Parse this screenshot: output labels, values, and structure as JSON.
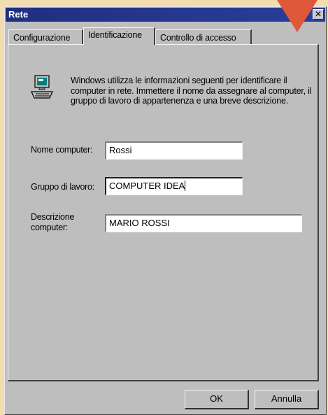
{
  "window": {
    "title": "Rete",
    "close_glyph": "✕"
  },
  "tabs": [
    {
      "label": "Configurazione",
      "active": false
    },
    {
      "label": "Identificazione",
      "active": true
    },
    {
      "label": "Controllo di accesso",
      "active": false
    }
  ],
  "identification": {
    "icon": "computer-icon",
    "info": "Windows utilizza le informazioni seguenti per identificare il computer in rete. Immettere il nome da assegnare al computer, il gruppo di lavoro di appartenenza e una breve descrizione.",
    "computer_name": {
      "label": "Nome computer:",
      "value": "Rossi"
    },
    "workgroup": {
      "label": "Gruppo di lavoro:",
      "value": "COMPUTER IDEA"
    },
    "description": {
      "label_line1": "Descrizione",
      "label_line2": "computer:",
      "value": "MARIO ROSSI"
    }
  },
  "buttons": {
    "ok": "OK",
    "cancel": "Annulla"
  },
  "colors": {
    "background": "#f2ddb0",
    "dialog": "#bebebe",
    "titlebar": "#1f2f80",
    "arrow": "#e0583a"
  }
}
